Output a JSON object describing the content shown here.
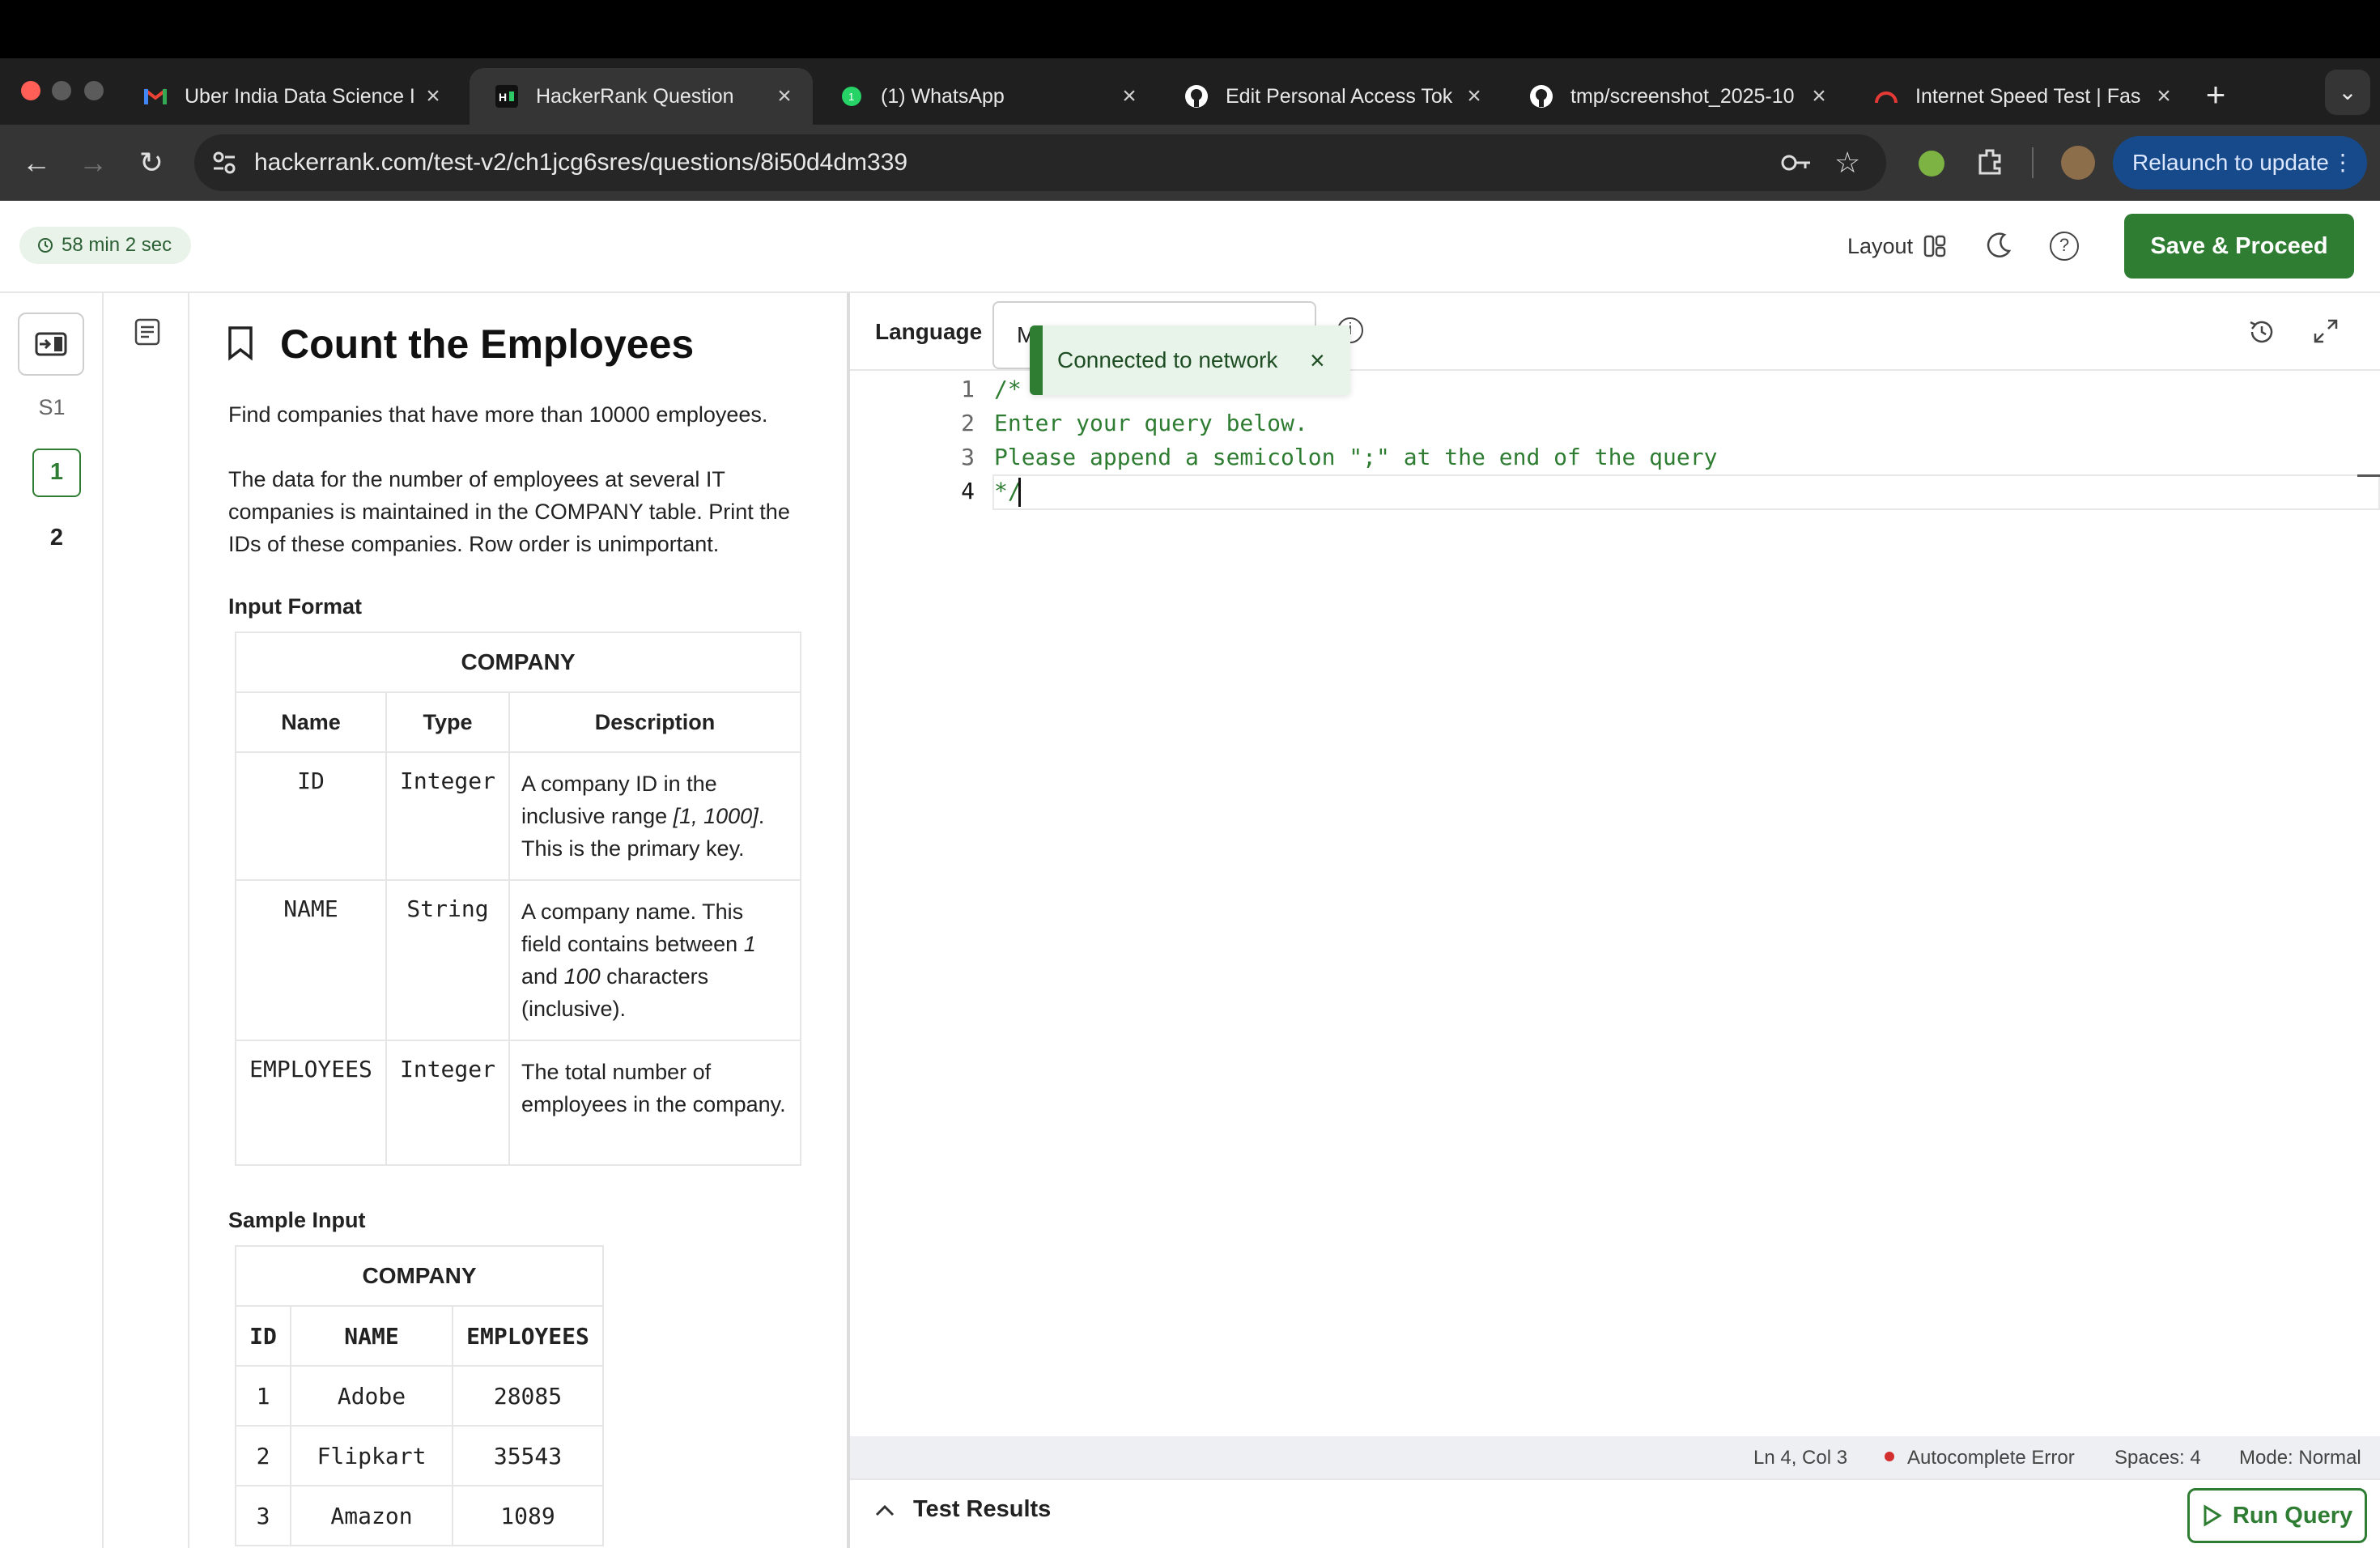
{
  "browser": {
    "tabs": [
      {
        "title": "Uber India Data Science I",
        "favicon": "gmail-icon",
        "active": false
      },
      {
        "title": "HackerRank Question",
        "favicon": "hackerrank-icon",
        "active": true
      },
      {
        "title": "(1) WhatsApp",
        "favicon": "whatsapp-icon",
        "active": false
      },
      {
        "title": "Edit Personal Access Tok",
        "favicon": "github-icon",
        "active": false
      },
      {
        "title": "tmp/screenshot_2025-10",
        "favicon": "github-icon",
        "active": false
      },
      {
        "title": "Internet Speed Test | Fas",
        "favicon": "speedometer-icon",
        "active": false
      }
    ],
    "new_tab": "+",
    "url": "hackerrank.com/test-v2/ch1jcg6sres/questions/8i50d4dm339",
    "relaunch_label": "Relaunch to update"
  },
  "header": {
    "timer": "58 min 2 sec",
    "layout_label": "Layout",
    "save_label": "Save & Proceed"
  },
  "rail": {
    "section": "S1",
    "questions": [
      "1",
      "2"
    ],
    "active_question": "1"
  },
  "problem": {
    "title": "Count the Employees",
    "intro": "Find companies that have more than 10000 employees.",
    "description": "The data for the number of employees at several IT companies is maintained in the COMPANY table. Print the IDs of these companies. Row order is unimportant.",
    "input_format_heading": "Input Format",
    "schema_table": {
      "caption": "COMPANY",
      "headers": [
        "Name",
        "Type",
        "Description"
      ],
      "rows": [
        {
          "name": "ID",
          "type": "Integer",
          "desc_html": "A company ID in the inclusive range <i>[1, 1000]</i>. This is the primary key."
        },
        {
          "name": "NAME",
          "type": "String",
          "desc_html": "A company name. This field contains between <i>1</i> and <i>100</i> characters (inclusive)."
        },
        {
          "name": "EMPLOYEES",
          "type": "Integer",
          "desc_html": "The total number of employees in the company."
        }
      ]
    },
    "sample_input_heading": "Sample Input",
    "sample_table": {
      "caption": "COMPANY",
      "headers": [
        "ID",
        "NAME",
        "EMPLOYEES"
      ],
      "rows": [
        [
          "1",
          "Adobe",
          "28085"
        ],
        [
          "2",
          "Flipkart",
          "35543"
        ],
        [
          "3",
          "Amazon",
          "1089"
        ]
      ]
    }
  },
  "editor": {
    "language_label": "Language",
    "language_value": "MySQL",
    "toast": "Connected to network",
    "line_numbers": [
      "1",
      "2",
      "3",
      "4"
    ],
    "code_lines": [
      "/*",
      "Enter your query below.",
      "Please append a semicolon \";\" at the end of the query",
      "*/"
    ],
    "status": {
      "position": "Ln 4, Col 3",
      "autocomplete": "Autocomplete Error",
      "spaces": "Spaces: 4",
      "mode": "Mode: Normal"
    },
    "test_results_label": "Test Results",
    "run_label": "Run Query"
  },
  "colors": {
    "brand_green": "#2e7d32",
    "error_dot": "#d32f2f"
  }
}
